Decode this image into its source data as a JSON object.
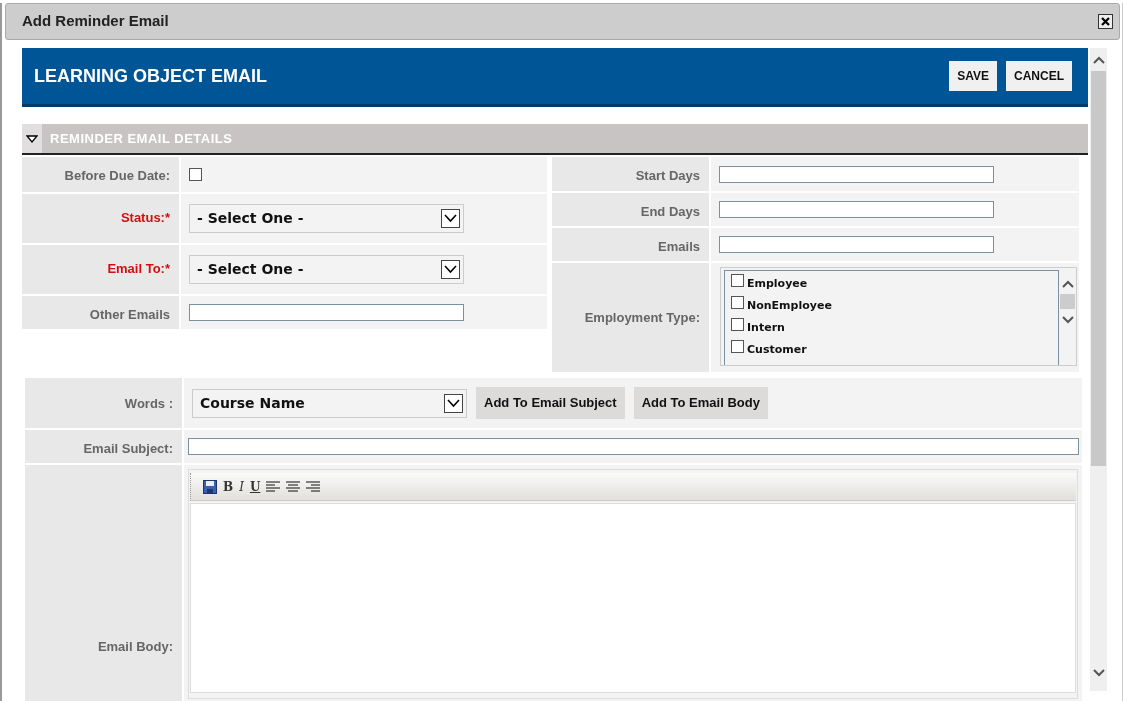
{
  "window": {
    "title": "Add Reminder Email"
  },
  "header": {
    "title": "LEARNING OBJECT EMAIL",
    "buttons": [
      "SAVE",
      "CANCEL"
    ]
  },
  "section": {
    "title": "REMINDER EMAIL DETAILS",
    "expanded": true
  },
  "left_fields": [
    {
      "label": "Before Due Date:",
      "kind": "checkbox",
      "required": false,
      "checked": false
    },
    {
      "label": "Status:*",
      "kind": "select",
      "required": true,
      "value": "- Select One -"
    },
    {
      "label": "Email To:*",
      "kind": "select",
      "required": true,
      "value": "- Select One -"
    },
    {
      "label": "Other Emails",
      "kind": "text",
      "required": false
    }
  ],
  "right_fields": [
    {
      "label": "Start Days",
      "kind": "text"
    },
    {
      "label": "End Days",
      "kind": "text"
    },
    {
      "label": "Emails",
      "kind": "text"
    },
    {
      "label": "Employment Type:",
      "kind": "checklist",
      "options": [
        {
          "label": "Employee",
          "checked": false
        },
        {
          "label": "NonEmployee",
          "checked": false
        },
        {
          "label": "Intern",
          "checked": false
        },
        {
          "label": "Customer",
          "checked": false
        }
      ]
    }
  ],
  "words": {
    "label": "Words :",
    "value": "Course Name",
    "buttons": [
      "Add To Email Subject",
      "Add To Email Body"
    ]
  },
  "email_subject": {
    "label": "Email Subject:"
  },
  "email_body": {
    "label": "Email Body:",
    "toolbar": [
      {
        "kind": "save"
      },
      {
        "kind": "bold",
        "text": "B"
      },
      {
        "kind": "italic",
        "text": "I"
      },
      {
        "kind": "underline",
        "text": "U"
      },
      {
        "kind": "align-left"
      },
      {
        "kind": "align-center"
      },
      {
        "kind": "align-right"
      }
    ]
  }
}
